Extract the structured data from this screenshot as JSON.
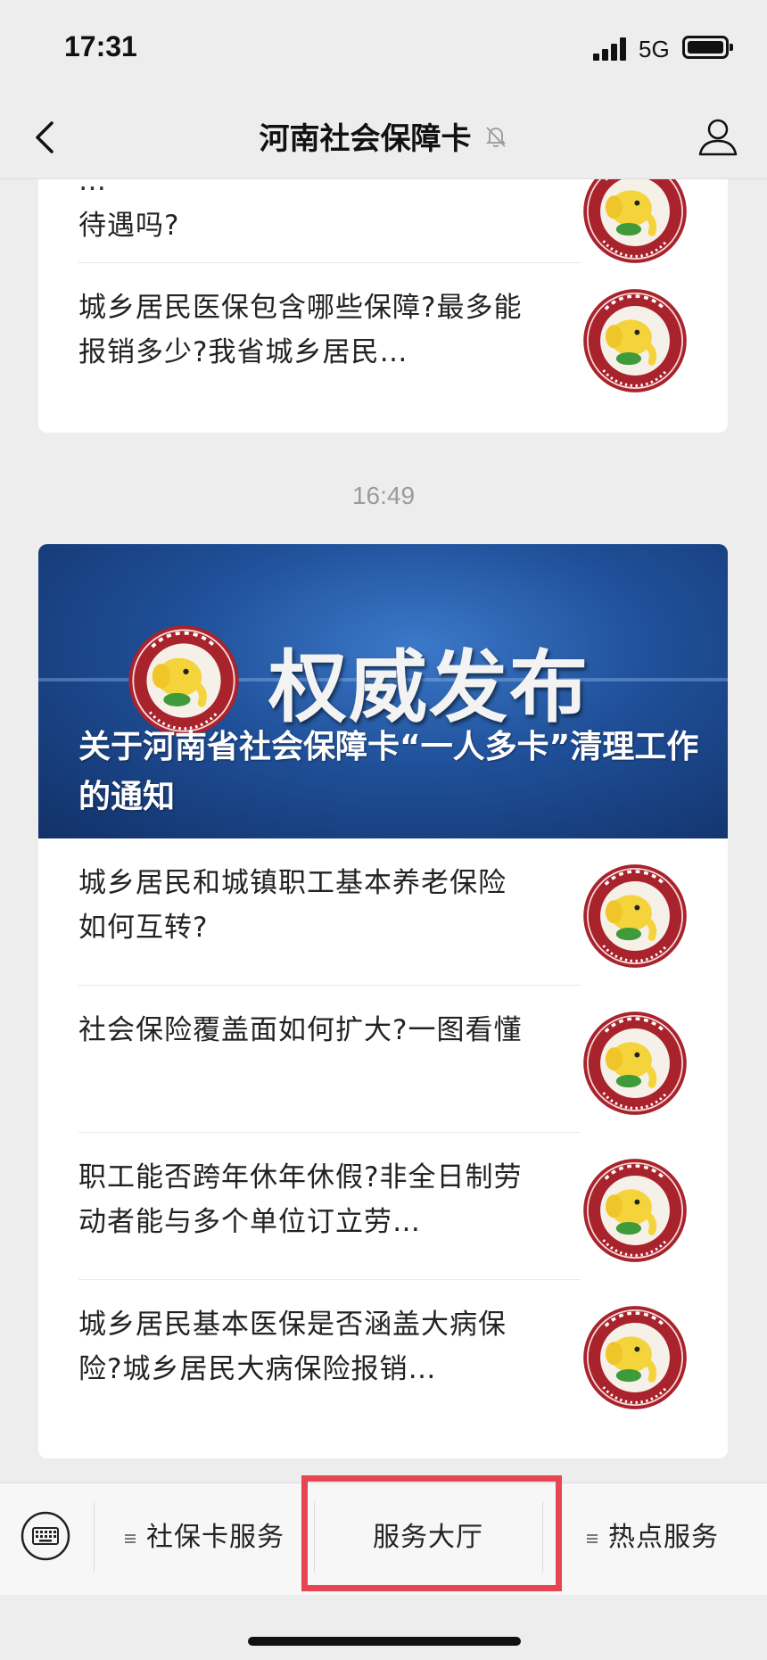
{
  "status_bar": {
    "time": "17:31",
    "network": "5G"
  },
  "nav": {
    "title": "河南社会保障卡"
  },
  "top_card": {
    "articles": [
      {
        "title": "…待遇吗?",
        "partial_line": "待遇吗?",
        "thumb": "social-security-card-logo"
      },
      {
        "title": "城乡居民医保包含哪些保障?最多能报销多少?我省城乡居民…"
      }
    ]
  },
  "timestamp": "16:49",
  "main_card": {
    "banner": {
      "headline": "权威发布",
      "title": "关于河南省社会保障卡“一人多卡”清理工作的通知"
    },
    "articles": [
      {
        "title": "城乡居民和城镇职工基本养老保险如何互转?"
      },
      {
        "title": "社会保险覆盖面如何扩大?一图看懂"
      },
      {
        "title": "职工能否跨年休年休假?非全日制劳动者能与多个单位订立劳…"
      },
      {
        "title": "城乡居民基本医保是否涵盖大病保险?城乡居民大病保险报销…"
      }
    ]
  },
  "bottom_menu": {
    "items": [
      {
        "label": "社保卡服务",
        "has_submenu": true
      },
      {
        "label": "服务大厅",
        "has_submenu": false,
        "highlighted": true
      },
      {
        "label": "热点服务",
        "has_submenu": true
      }
    ]
  },
  "colors": {
    "background": "#ededed",
    "highlight_box": "#e54652",
    "logo_red": "#a8232c",
    "logo_yellow": "#f4d43a",
    "banner_blue": "#1f4f98"
  }
}
